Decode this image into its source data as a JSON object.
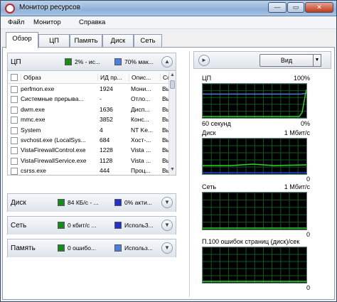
{
  "window": {
    "title": "Монитор ресурсов",
    "buttons": {
      "minimize": "—",
      "maximize": "▭",
      "close": "✕"
    }
  },
  "menu": [
    "Файл",
    "Монитор",
    "Справка"
  ],
  "tabs": [
    {
      "label": "Обзор",
      "active": true
    },
    {
      "label": "ЦП",
      "active": false
    },
    {
      "label": "Память",
      "active": false
    },
    {
      "label": "Диск",
      "active": false
    },
    {
      "label": "Сеть",
      "active": false
    }
  ],
  "cpu": {
    "title": "ЦП",
    "legend1": {
      "color": "#1a8a1a",
      "text": "2% - ис..."
    },
    "legend2": {
      "color": "#4a7fe0",
      "text": "70% мак..."
    },
    "columns": [
      "Образ",
      "ИД пр...",
      "Опис...",
      "Со"
    ],
    "rows": [
      {
        "image": "perfmon.exe",
        "pid": "1924",
        "desc": "Мони...",
        "state": "Вы"
      },
      {
        "image": "Системные прерыва...",
        "pid": "-",
        "desc": "Отло...",
        "state": "Вы"
      },
      {
        "image": "dwm.exe",
        "pid": "1636",
        "desc": "Дисп...",
        "state": "Вы"
      },
      {
        "image": "mmc.exe",
        "pid": "3852",
        "desc": "Конс...",
        "state": "Вы"
      },
      {
        "image": "System",
        "pid": "4",
        "desc": "NT Ke...",
        "state": "Вы"
      },
      {
        "image": "svchost.exe (LocalSys...",
        "pid": "684",
        "desc": "Хост-...",
        "state": "Вы"
      },
      {
        "image": "VistaFirewallControl.exe",
        "pid": "1228",
        "desc": "Vista ...",
        "state": "Вы"
      },
      {
        "image": "VistaFirewallService.exe",
        "pid": "1128",
        "desc": "Vista ...",
        "state": "Вы"
      },
      {
        "image": "csrss.exe",
        "pid": "444",
        "desc": "Проц...",
        "state": "Вы"
      }
    ]
  },
  "disk": {
    "title": "Диск",
    "legend1": {
      "color": "#1a8a1a",
      "text": "84 КБ/с - ..."
    },
    "legend2": {
      "color": "#2030c8",
      "text": "0% акти..."
    }
  },
  "network": {
    "title": "Сеть",
    "legend1": {
      "color": "#1a8a1a",
      "text": "0 кбит/с ..."
    },
    "legend2": {
      "color": "#2030c8",
      "text": "Исполь3..."
    }
  },
  "memory": {
    "title": "Память",
    "legend1": {
      "color": "#1a8a1a",
      "text": "0 ошибо..."
    },
    "legend2": {
      "color": "#4a7fe0",
      "text": "Использ..."
    }
  },
  "right": {
    "view_button": "Вид",
    "graphs": [
      {
        "name": "ЦП",
        "max": "100%",
        "time": "60 секунд",
        "min": "0%"
      },
      {
        "name": "Диск",
        "max": "1 Мбит/с",
        "min": "0"
      },
      {
        "name": "Сеть",
        "max": "1 Мбит/с",
        "min": "0"
      },
      {
        "name": "П.100 ошибок страниц (диск)/сек",
        "max": "",
        "min": "0"
      }
    ]
  }
}
